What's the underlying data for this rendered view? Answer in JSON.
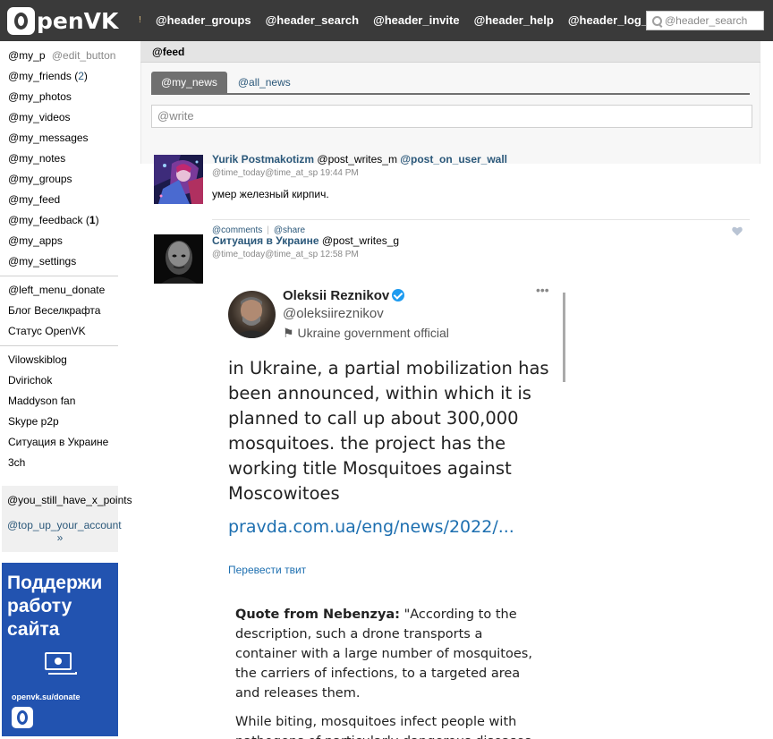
{
  "header": {
    "logo_text": "penVK",
    "nav_separator": "!",
    "nav": [
      "@header_groups",
      "@header_search",
      "@header_invite",
      "@header_help",
      "@header_log_out"
    ],
    "search_placeholder": "@header_search"
  },
  "sidebar": {
    "my_page": "@my_p",
    "edit_button": "@edit_button",
    "friends_label": "@my_friends",
    "friends_count": "2",
    "photos": "@my_photos",
    "videos": "@my_videos",
    "messages": "@my_messages",
    "notes": "@my_notes",
    "groups": "@my_groups",
    "feed": "@my_feed",
    "feedback_label": "@my_feedback",
    "feedback_count": "1",
    "apps": "@my_apps",
    "settings": "@my_settings",
    "links": [
      "@left_menu_donate",
      "Блог Веселкрафта",
      "Статус OpenVK"
    ],
    "groups_list": [
      "Vilowskiblog",
      "Dvirichok",
      "Maddyson fan",
      "Skype p2p",
      "Ситуация в Украине",
      "3ch"
    ],
    "points_text": "@you_still_have_x_points",
    "topup_text": "@top_up_your_account »",
    "banner": {
      "title": "Поддержи работу сайта",
      "url": "openvk.su/donate",
      "color": "#2253b0"
    }
  },
  "main": {
    "page_title": "@feed",
    "tabs": [
      "@my_news",
      "@all_news"
    ],
    "write_placeholder": "@write",
    "posts": [
      {
        "author": "Yurik Postmakotizm",
        "action": "@post_writes_m",
        "wall_link": "@post_on_user_wall",
        "time": "@time_today@time_at_sp 19:44 PM",
        "text": "умер железный кирпич.",
        "comments": "@comments",
        "share": "@share"
      },
      {
        "author": "Ситуация в Украине",
        "action": "@post_writes_g",
        "time": "@time_today@time_at_sp 12:58 PM",
        "tweet": {
          "name": "Oleksii Reznikov",
          "handle": "@oleksiireznikov",
          "affiliation": "Ukraine government official",
          "body": "in Ukraine, a partial mobilization has been announced, within which it is planned to call up about 300,000 mosquitoes. the project has the working title Mosquitoes against Moscowitoes",
          "link": "pravda.com.ua/eng/news/2022/...",
          "translate": "Перевести твит",
          "quote_label": "Quote from Nebenzya:",
          "quote_text": " \"According to the description, such a drone transports a container with a large number of mosquitoes, the carriers of infections, to a targeted area and releases them.",
          "quote_text2": "While biting, mosquitoes infect people with pathogens of particularly dangerous diseases"
        }
      }
    ]
  },
  "colors": {
    "header_bg": "#3a3a3a",
    "link": "#2b587a",
    "tab_active": "#707070"
  }
}
